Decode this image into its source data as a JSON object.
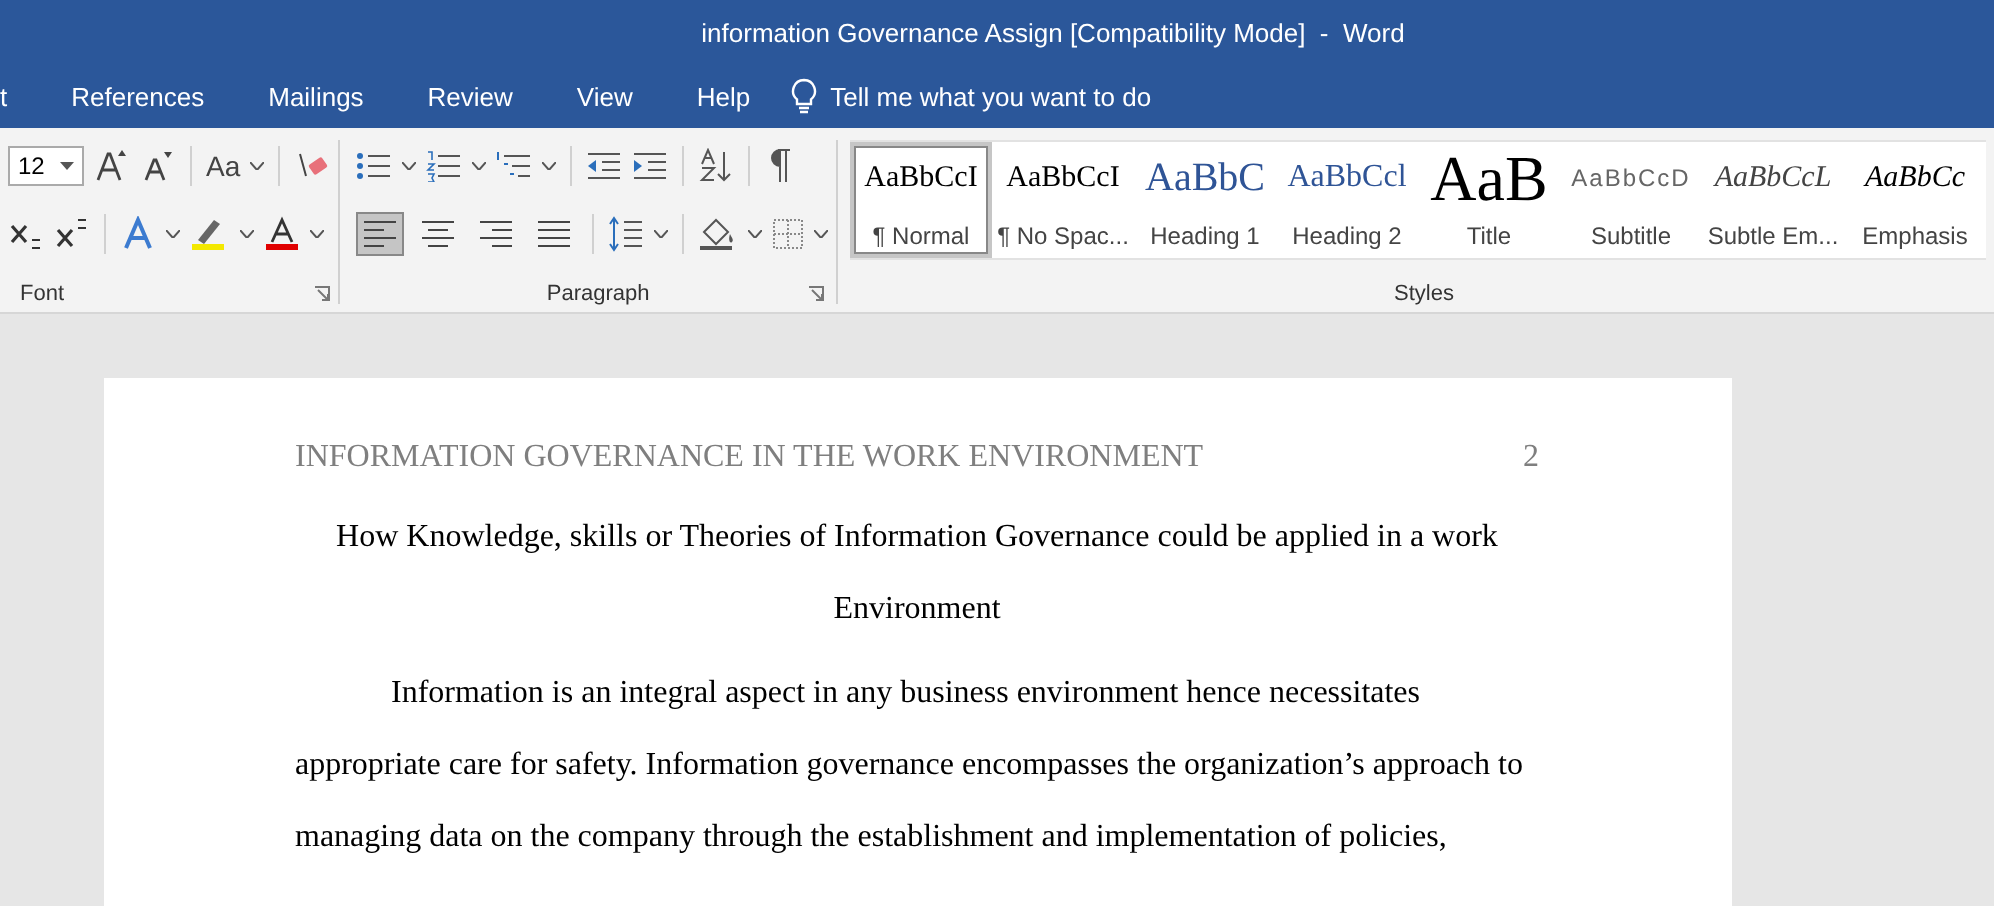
{
  "window": {
    "title": "information Governance Assign [Compatibility Mode]  -  Word"
  },
  "tabs": [
    {
      "label": "t",
      "selected": false
    },
    {
      "label": "References",
      "selected": false
    },
    {
      "label": "Mailings",
      "selected": false
    },
    {
      "label": "Review",
      "selected": false
    },
    {
      "label": "View",
      "selected": false
    },
    {
      "label": "Help",
      "selected": false
    }
  ],
  "tell_me": {
    "placeholder": "Tell me what you want to do"
  },
  "font_group": {
    "label": "Font",
    "font_size": "12",
    "change_case": "Aa"
  },
  "paragraph_group": {
    "label": "Paragraph",
    "alignment": [
      {
        "kind": "left",
        "selected": true
      },
      {
        "kind": "center",
        "selected": false
      },
      {
        "kind": "right",
        "selected": false
      },
      {
        "kind": "justify",
        "selected": false
      }
    ]
  },
  "styles_group": {
    "label": "Styles",
    "styles": [
      {
        "preview": "AaBbCcI",
        "name": "¶ Normal",
        "kind": "normal",
        "selected": true
      },
      {
        "preview": "AaBbCcI",
        "name": "¶ No Spac...",
        "kind": "normal",
        "selected": false
      },
      {
        "preview": "AaBbC",
        "name": "Heading 1",
        "kind": "heading1",
        "selected": false
      },
      {
        "preview": "AaBbCcl",
        "name": "Heading 2",
        "kind": "heading2",
        "selected": false
      },
      {
        "preview": "AaB",
        "name": "Title",
        "kind": "title",
        "selected": false
      },
      {
        "preview": "AaBbCcD",
        "name": "Subtitle",
        "kind": "subtitle",
        "selected": false
      },
      {
        "preview": "AaBbCcL",
        "name": "Subtle Em...",
        "kind": "subtle",
        "selected": false
      },
      {
        "preview": "AaBbCc",
        "name": "Emphasis",
        "kind": "emphasis",
        "selected": false
      }
    ]
  },
  "document": {
    "running_head": "INFORMATION GOVERNANCE IN THE WORK ENVIRONMENT",
    "page_number": "2",
    "heading": "How Knowledge, skills or Theories of Information Governance could be applied in a work Environment",
    "paragraph": "Information is an integral aspect in any business environment hence necessitates appropriate care for safety. Information governance encompasses the organization’s approach to managing data on the company through the establishment and implementation of policies,"
  }
}
